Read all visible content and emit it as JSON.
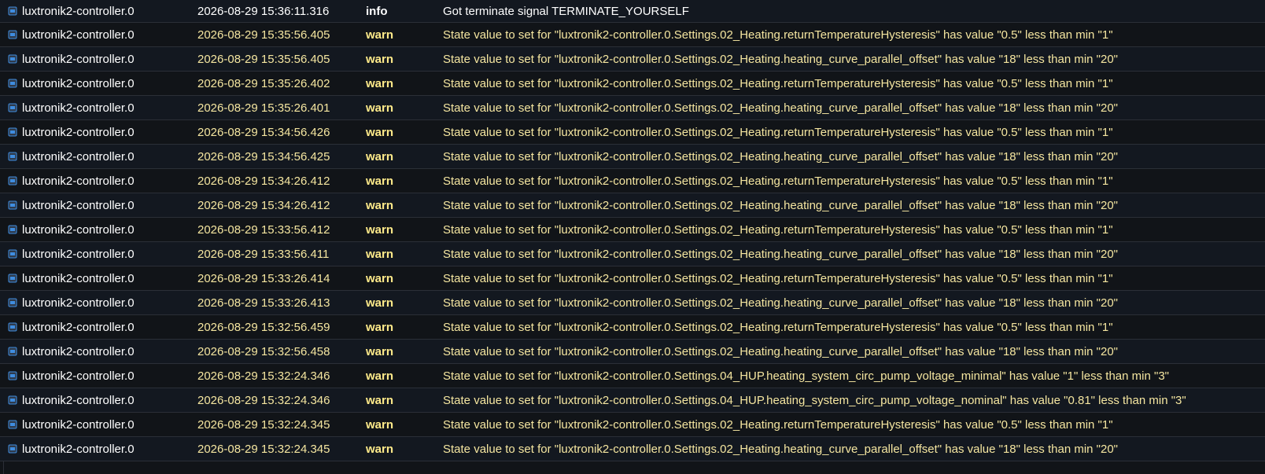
{
  "log": {
    "rows": [
      {
        "source": "luxtronik2-controller.0",
        "time": "2026-08-29 15:36:11.316",
        "level": "info",
        "message": "Got terminate signal TERMINATE_YOURSELF"
      },
      {
        "source": "luxtronik2-controller.0",
        "time": "2026-08-29 15:35:56.405",
        "level": "warn",
        "message": "State value to set for \"luxtronik2-controller.0.Settings.02_Heating.returnTemperatureHysteresis\" has value \"0.5\" less than min \"1\""
      },
      {
        "source": "luxtronik2-controller.0",
        "time": "2026-08-29 15:35:56.405",
        "level": "warn",
        "message": "State value to set for \"luxtronik2-controller.0.Settings.02_Heating.heating_curve_parallel_offset\" has value \"18\" less than min \"20\""
      },
      {
        "source": "luxtronik2-controller.0",
        "time": "2026-08-29 15:35:26.402",
        "level": "warn",
        "message": "State value to set for \"luxtronik2-controller.0.Settings.02_Heating.returnTemperatureHysteresis\" has value \"0.5\" less than min \"1\""
      },
      {
        "source": "luxtronik2-controller.0",
        "time": "2026-08-29 15:35:26.401",
        "level": "warn",
        "message": "State value to set for \"luxtronik2-controller.0.Settings.02_Heating.heating_curve_parallel_offset\" has value \"18\" less than min \"20\""
      },
      {
        "source": "luxtronik2-controller.0",
        "time": "2026-08-29 15:34:56.426",
        "level": "warn",
        "message": "State value to set for \"luxtronik2-controller.0.Settings.02_Heating.returnTemperatureHysteresis\" has value \"0.5\" less than min \"1\""
      },
      {
        "source": "luxtronik2-controller.0",
        "time": "2026-08-29 15:34:56.425",
        "level": "warn",
        "message": "State value to set for \"luxtronik2-controller.0.Settings.02_Heating.heating_curve_parallel_offset\" has value \"18\" less than min \"20\""
      },
      {
        "source": "luxtronik2-controller.0",
        "time": "2026-08-29 15:34:26.412",
        "level": "warn",
        "message": "State value to set for \"luxtronik2-controller.0.Settings.02_Heating.returnTemperatureHysteresis\" has value \"0.5\" less than min \"1\""
      },
      {
        "source": "luxtronik2-controller.0",
        "time": "2026-08-29 15:34:26.412",
        "level": "warn",
        "message": "State value to set for \"luxtronik2-controller.0.Settings.02_Heating.heating_curve_parallel_offset\" has value \"18\" less than min \"20\""
      },
      {
        "source": "luxtronik2-controller.0",
        "time": "2026-08-29 15:33:56.412",
        "level": "warn",
        "message": "State value to set for \"luxtronik2-controller.0.Settings.02_Heating.returnTemperatureHysteresis\" has value \"0.5\" less than min \"1\""
      },
      {
        "source": "luxtronik2-controller.0",
        "time": "2026-08-29 15:33:56.411",
        "level": "warn",
        "message": "State value to set for \"luxtronik2-controller.0.Settings.02_Heating.heating_curve_parallel_offset\" has value \"18\" less than min \"20\""
      },
      {
        "source": "luxtronik2-controller.0",
        "time": "2026-08-29 15:33:26.414",
        "level": "warn",
        "message": "State value to set for \"luxtronik2-controller.0.Settings.02_Heating.returnTemperatureHysteresis\" has value \"0.5\" less than min \"1\""
      },
      {
        "source": "luxtronik2-controller.0",
        "time": "2026-08-29 15:33:26.413",
        "level": "warn",
        "message": "State value to set for \"luxtronik2-controller.0.Settings.02_Heating.heating_curve_parallel_offset\" has value \"18\" less than min \"20\""
      },
      {
        "source": "luxtronik2-controller.0",
        "time": "2026-08-29 15:32:56.459",
        "level": "warn",
        "message": "State value to set for \"luxtronik2-controller.0.Settings.02_Heating.returnTemperatureHysteresis\" has value \"0.5\" less than min \"1\""
      },
      {
        "source": "luxtronik2-controller.0",
        "time": "2026-08-29 15:32:56.458",
        "level": "warn",
        "message": "State value to set for \"luxtronik2-controller.0.Settings.02_Heating.heating_curve_parallel_offset\" has value \"18\" less than min \"20\""
      },
      {
        "source": "luxtronik2-controller.0",
        "time": "2026-08-29 15:32:24.346",
        "level": "warn",
        "message": "State value to set for \"luxtronik2-controller.0.Settings.04_HUP.heating_system_circ_pump_voltage_minimal\" has value \"1\" less than min \"3\""
      },
      {
        "source": "luxtronik2-controller.0",
        "time": "2026-08-29 15:32:24.346",
        "level": "warn",
        "message": "State value to set for \"luxtronik2-controller.0.Settings.04_HUP.heating_system_circ_pump_voltage_nominal\" has value \"0.81\" less than min \"3\""
      },
      {
        "source": "luxtronik2-controller.0",
        "time": "2026-08-29 15:32:24.345",
        "level": "warn",
        "message": "State value to set for \"luxtronik2-controller.0.Settings.02_Heating.returnTemperatureHysteresis\" has value \"0.5\" less than min \"1\""
      },
      {
        "source": "luxtronik2-controller.0",
        "time": "2026-08-29 15:32:24.345",
        "level": "warn",
        "message": "State value to set for \"luxtronik2-controller.0.Settings.02_Heating.heating_curve_parallel_offset\" has value \"18\" less than min \"20\""
      }
    ]
  },
  "colors": {
    "background": "#111418",
    "info_text": "#ffffff",
    "warn_text": "#f5e6a0",
    "warn_level": "#ffeb8a",
    "icon_accent": "#3f8de0"
  },
  "icons": {
    "source_icon": "adapter-icon"
  }
}
